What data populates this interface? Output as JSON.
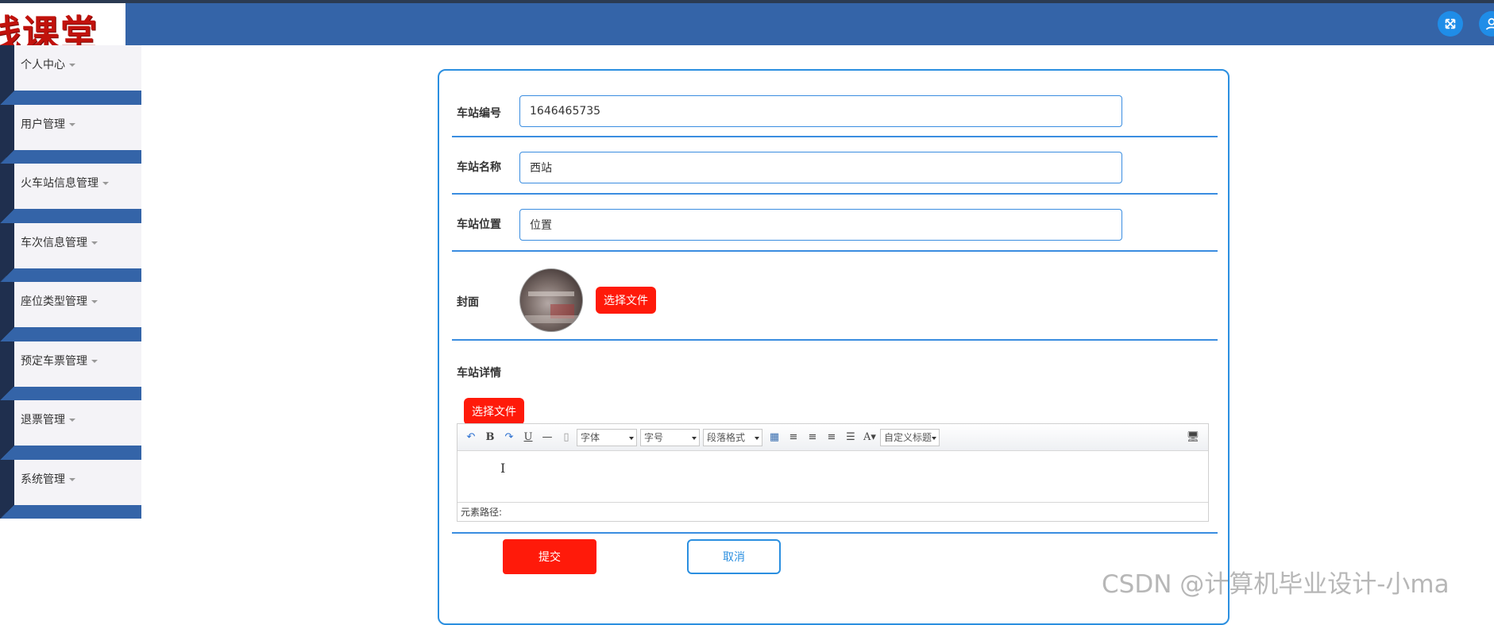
{
  "header": {
    "logo_text": "线课堂"
  },
  "top_icons": [
    "fullscreen-icon",
    "user-icon"
  ],
  "sidebar": {
    "items": [
      {
        "label": "个人中心"
      },
      {
        "label": "用户管理"
      },
      {
        "label": "火车站信息管理"
      },
      {
        "label": "车次信息管理"
      },
      {
        "label": "座位类型管理"
      },
      {
        "label": "预定车票管理"
      },
      {
        "label": "退票管理"
      },
      {
        "label": "系统管理"
      }
    ]
  },
  "form": {
    "station_id": {
      "label": "车站编号",
      "value": "1646465735"
    },
    "station_name": {
      "label": "车站名称",
      "value": "西站"
    },
    "station_location": {
      "label": "车站位置",
      "value": "位置"
    },
    "cover": {
      "label": "封面",
      "button": "选择文件"
    },
    "details": {
      "label": "车站详情",
      "button": "选择文件"
    },
    "editor": {
      "font_select": "字体",
      "size_select": "字号",
      "paragraph_select": "段落格式",
      "custom_title_select": "自定义标题",
      "path_label": "元素路径:"
    },
    "submit_label": "提交",
    "cancel_label": "取消"
  },
  "watermark": "CSDN @计算机毕业设计-小ma",
  "colors": {
    "header_blue": "#3464a8",
    "accent_blue": "#2b8fe0",
    "button_red": "#ff1a0a",
    "sidebar_dark": "#1f2f4e"
  }
}
